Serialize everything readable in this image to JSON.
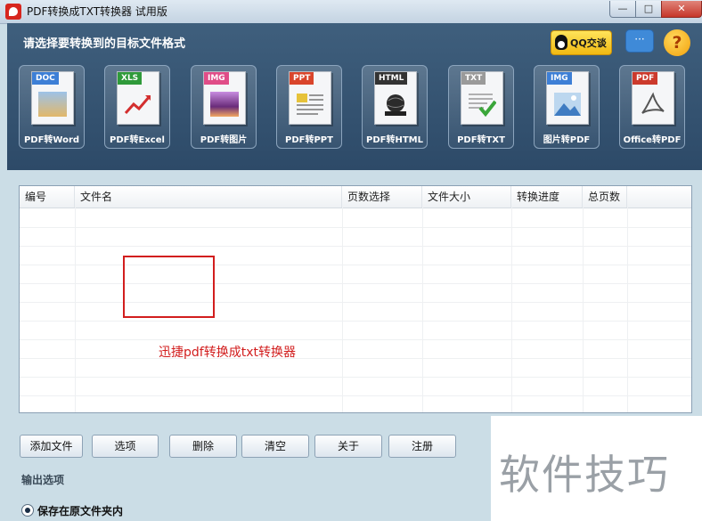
{
  "window": {
    "title": "PDF转换成TXT转换器 试用版",
    "controls": [
      "—",
      "□",
      "✕"
    ]
  },
  "header": {
    "prompt": "请选择要转换到的目标文件格式",
    "qq_label": "QQ交谈",
    "chat_icon": "speech-bubble-icon",
    "help_glyph": "?"
  },
  "tools": [
    {
      "tag": "DOC",
      "label": "PDF转Word",
      "color": "#3d7fd6"
    },
    {
      "tag": "XLS",
      "label": "PDF转Excel",
      "color": "#2f9a3a"
    },
    {
      "tag": "IMG",
      "label": "PDF转图片",
      "color": "#e04d88"
    },
    {
      "tag": "PPT",
      "label": "PDF转PPT",
      "color": "#d9452b"
    },
    {
      "tag": "HTML",
      "label": "PDF转HTML",
      "color": "#333333"
    },
    {
      "tag": "TXT",
      "label": "PDF转TXT",
      "color": "#9a9a9a"
    },
    {
      "tag": "IMG",
      "label": "图片转PDF",
      "color": "#3d7fd6"
    },
    {
      "tag": "PDF",
      "label": "Office转PDF",
      "color": "#cc3a2c"
    }
  ],
  "table": {
    "columns": [
      "编号",
      "文件名",
      "页数选择",
      "文件大小",
      "转换进度",
      "总页数"
    ],
    "rows": []
  },
  "overlay_text": "迅捷pdf转换成txt转换器",
  "buttons": [
    "添加文件",
    "选项",
    "删除",
    "清空",
    "关于",
    "注册"
  ],
  "output": {
    "section_label": "输出选项",
    "radio_label": "保存在原文件夹内"
  },
  "watermark": "软件技巧"
}
